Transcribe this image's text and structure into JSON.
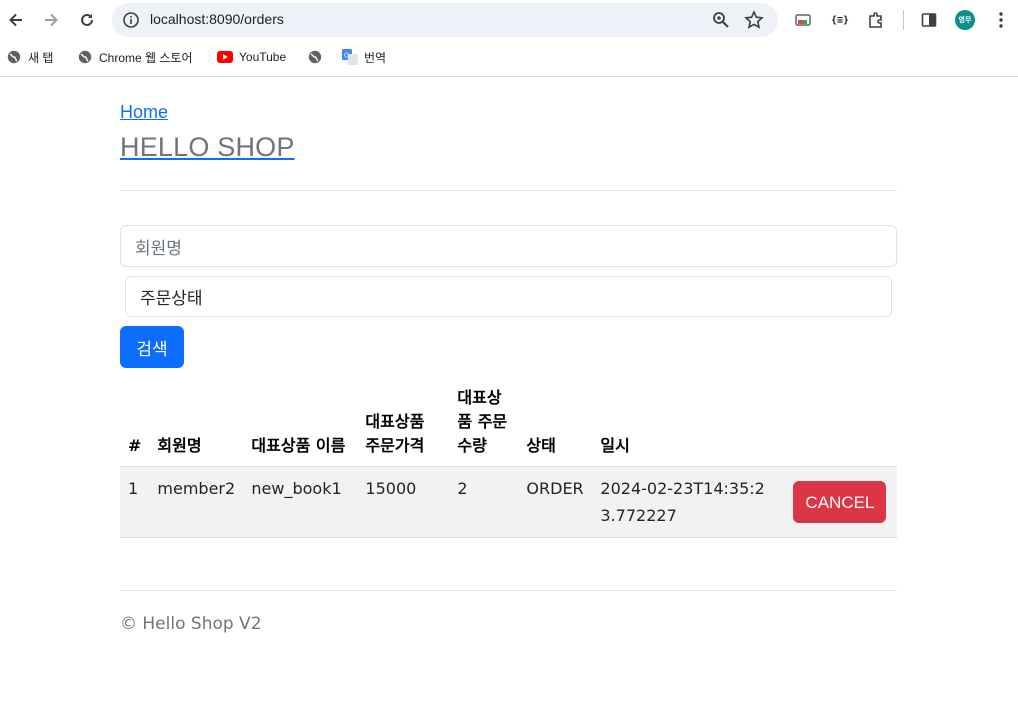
{
  "browser": {
    "url": "localhost:8090/orders",
    "bookmarks": [
      {
        "label": "새 탭",
        "icon": "globe-icon"
      },
      {
        "label": "Chrome 웹 스토어",
        "icon": "globe-icon"
      },
      {
        "label": "YouTube",
        "icon": "youtube-icon"
      },
      {
        "label": "",
        "icon": "globe-icon"
      },
      {
        "label": "번역",
        "icon": "translate-icon"
      }
    ],
    "avatar_text": "영무"
  },
  "page": {
    "home_link": "Home",
    "title": "HELLO SHOP",
    "search": {
      "member_placeholder": "회원명",
      "status_value": "주문상태",
      "button_label": "검색"
    },
    "table": {
      "headers": [
        "#",
        "회원명",
        "대표상품 이름",
        "대표상품 주문가격",
        "대표상품 주문 수량",
        "상태",
        "일시",
        ""
      ],
      "rows": [
        {
          "id": "1",
          "member": "member2",
          "item_name": "new_book1",
          "price": "15000",
          "count": "2",
          "status": "ORDER",
          "date": "2024-02-23T14:35:23.772227",
          "action_label": "CANCEL"
        }
      ]
    },
    "footer": "© Hello Shop V2"
  },
  "colors": {
    "primary": "#0d6efd",
    "danger": "#dc3545",
    "muted": "#6c757d"
  }
}
